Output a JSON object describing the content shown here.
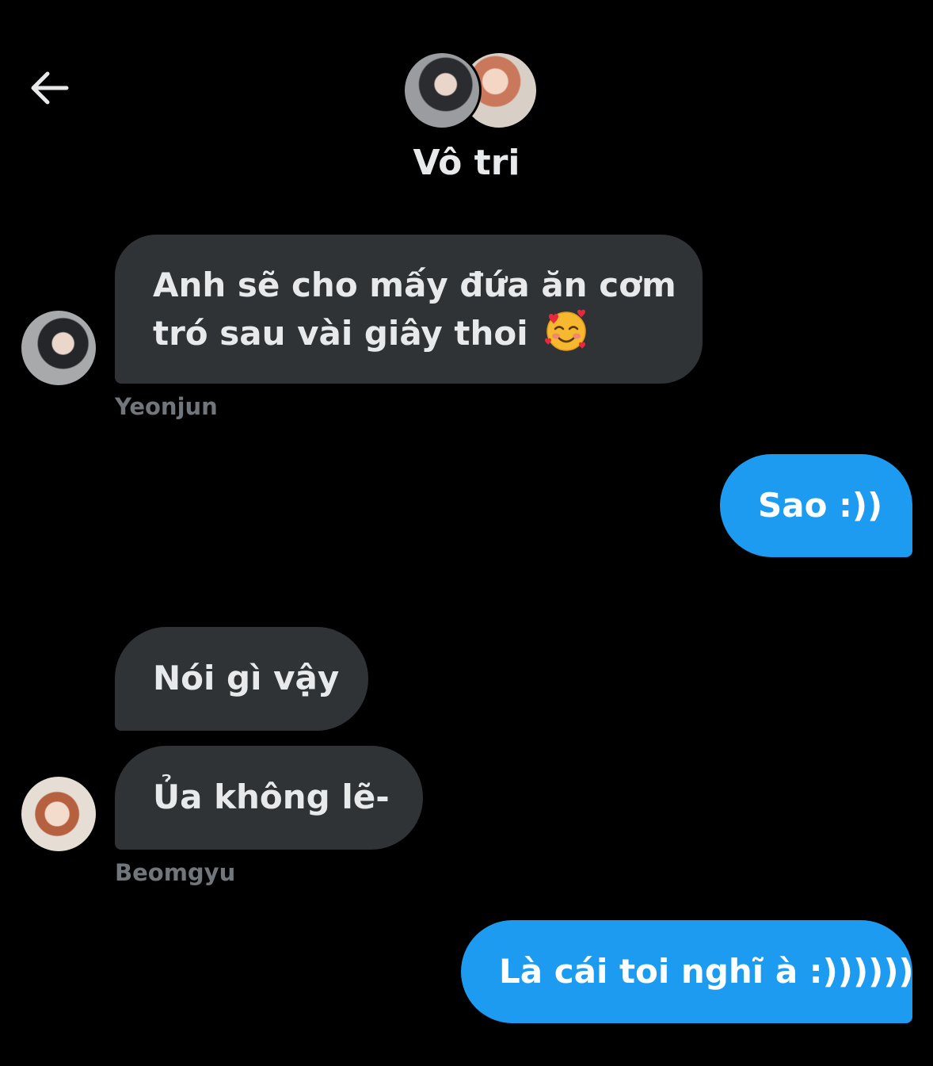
{
  "header": {
    "back_icon": "arrow-left-icon",
    "title": "Vô tri",
    "avatars": [
      "Yeonjun",
      "Beomgyu"
    ]
  },
  "messages": [
    {
      "direction": "incoming",
      "lines": [
        "Anh sẽ cho mấy đứa ăn cơm",
        "tró sau vài giây thoi"
      ],
      "emoji": "smiling-face-with-hearts-icon",
      "sender": "Yeonjun"
    },
    {
      "direction": "outgoing",
      "text": "Sao :))"
    },
    {
      "direction": "incoming",
      "text": "Nói gì vậy"
    },
    {
      "direction": "incoming",
      "text": "Ủa không lẽ-",
      "sender": "Beomgyu"
    },
    {
      "direction": "outgoing",
      "text": "Là cái toi nghĩ à :))))))"
    }
  ],
  "colors": {
    "background": "#000000",
    "incoming_bubble": "#2f3336",
    "outgoing_bubble": "#1d9bf0",
    "sender_label": "#71767b",
    "text": "#e7e9ea"
  }
}
